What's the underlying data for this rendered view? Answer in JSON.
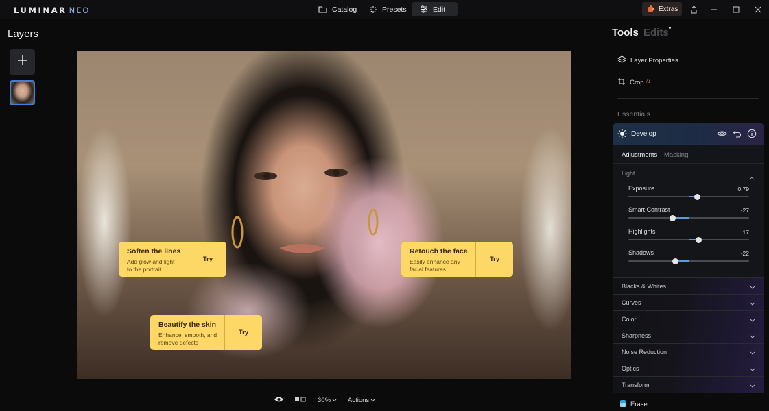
{
  "app": {
    "logo_main": "LUMINAR",
    "logo_sub": "NEO"
  },
  "nav": {
    "catalog": "Catalog",
    "presets": "Presets",
    "edit": "Edit",
    "extras": "Extras"
  },
  "layers": {
    "title": "Layers"
  },
  "tips": [
    {
      "title": "Soften the lines",
      "desc1": "Add glow and light",
      "desc2": "to the portrait",
      "action": "Try"
    },
    {
      "title": "Retouch the face",
      "desc1": "Easily enhance any",
      "desc2": "facial features",
      "action": "Try"
    },
    {
      "title": "Beautify the skin",
      "desc1": "Enhance, smooth, and",
      "desc2": "remove defects",
      "action": "Try"
    }
  ],
  "bottom": {
    "zoom": "30%",
    "actions": "Actions"
  },
  "panel": {
    "tools_tab": "Tools",
    "edits_tab": "Edits",
    "layer_properties": "Layer Properties",
    "crop": "Crop",
    "crop_badge": "AI",
    "essentials": "Essentials"
  },
  "develop": {
    "title": "Develop",
    "tab_adjustments": "Adjustments",
    "tab_masking": "Masking",
    "group": "Light",
    "sliders": [
      {
        "label": "Exposure",
        "value": "0,79",
        "pos": 0.57
      },
      {
        "label": "Smart Contrast",
        "value": "-27",
        "pos": 0.365
      },
      {
        "label": "Highlights",
        "value": "17",
        "pos": 0.585
      },
      {
        "label": "Shadows",
        "value": "-22",
        "pos": 0.39
      }
    ]
  },
  "sections": [
    "Blacks & Whites",
    "Curves",
    "Color",
    "Sharpness",
    "Noise Reduction",
    "Optics",
    "Transform"
  ],
  "erase": "Erase",
  "colors": {
    "accent": "#3d7fd6",
    "tip_bg": "#fdd866",
    "slider_fill": "#5a9be0"
  }
}
